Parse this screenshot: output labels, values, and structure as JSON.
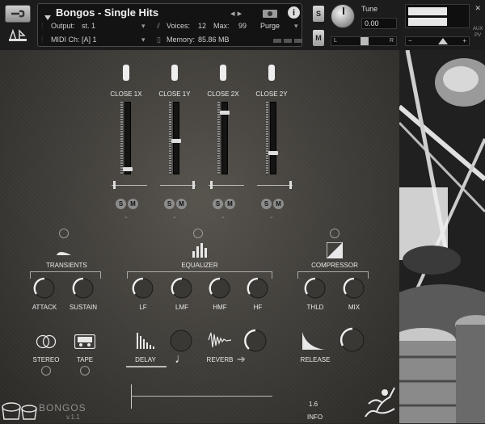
{
  "header": {
    "instrument_name": "Bongos - Single Hits",
    "output_label": "Output:",
    "output_value": "st. 1",
    "voices_label": "Voices:",
    "voices_value": "12",
    "max_label": "Max:",
    "max_value": "99",
    "purge_label": "Purge",
    "midi_label": "MIDI Ch:",
    "midi_value": "[A] 1",
    "memory_label": "Memory:",
    "memory_value": "85.86 MB",
    "solo_label": "S",
    "mute_label": "M",
    "tune_label": "Tune",
    "tune_value": "0.00",
    "pan_left": "L",
    "pan_right": "R",
    "aux_label": "AUX",
    "pv_label": "PV",
    "vol_minus": "−",
    "vol_plus": "+"
  },
  "mixer": {
    "channels": [
      {
        "label": "CLOSE 1X",
        "solo": "S",
        "mute": "M"
      },
      {
        "label": "CLOSE 1Y",
        "solo": "S",
        "mute": "M"
      },
      {
        "label": "CLOSE 2X",
        "solo": "S",
        "mute": "M"
      },
      {
        "label": "CLOSE 2Y",
        "solo": "S",
        "mute": "M"
      }
    ]
  },
  "sections": {
    "transients": "TRANSIENTS",
    "equalizer": "EQUALIZER",
    "compressor": "COMPRESSOR"
  },
  "knobs": {
    "attack": "ATTACK",
    "sustain": "SUSTAIN",
    "lf": "LF",
    "lmf": "LMF",
    "hmf": "HMF",
    "hf": "HF",
    "thld": "THLD",
    "mix": "MIX",
    "release": "RELEASE"
  },
  "effects": {
    "stereo": "STEREO",
    "tape": "TAPE",
    "delay": "DELAY",
    "reverb": "REVERB"
  },
  "footer": {
    "logo_text": "BONGOS",
    "version": "v.1.1",
    "version_number": "1.6",
    "info": "INFO"
  }
}
